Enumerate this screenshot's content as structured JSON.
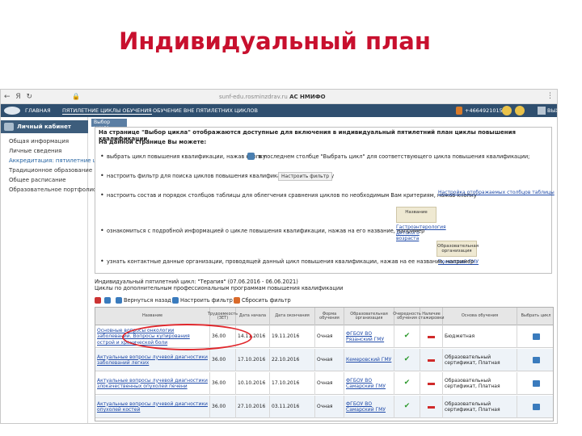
{
  "slide": {
    "title": "Индивидуальный план"
  },
  "browser": {
    "nav": "← Я ↻",
    "url_prefix": "sunf-edu.rosminzdrav.ru",
    "url_bold": "АС НМИФО",
    "menu": "⋮"
  },
  "app_header": {
    "menu": [
      "ГЛАВНАЯ",
      "ПЯТИЛЕТНИЕ ЦИКЛЫ ОБУЧЕНИЯ",
      "ОБУЧЕНИЕ ВНЕ ПЯТИЛЕТНИХ ЦИКЛОВ"
    ],
    "phone": "+4664921015",
    "exit": "ВЫХОД"
  },
  "sidebar": {
    "title": "Личный кабинет",
    "items": [
      {
        "label": "Общая информация"
      },
      {
        "label": "Личные сведения"
      },
      {
        "label": "Аккредитация: пятилетние цикл"
      },
      {
        "label": "Традиционное образование"
      },
      {
        "label": "Общее расписание"
      },
      {
        "label": "Образовательное портфолио"
      }
    ]
  },
  "main": {
    "tab": "Выбор цикла",
    "info_first": "На странице \"Выбор цикла\" отображаются доступные для включения в индивидуальный пятилетний план циклы повышения квалификации.",
    "info_heading": "На данной странице Вы можете:",
    "bullets": [
      {
        "a": "выбрать цикл повышения квалификации, нажав кнопку",
        "b": "в последнем столбце \"Выбрать цикл\" для соответствующего цикла повышения квалификации;"
      },
      {
        "a": "настроить фильтр для поиска циклов повышения квалификации, нажав кнопку"
      },
      {
        "a": "настроить состав и порядок столбцов таблицы для облегчения сравнения циклов по необходимым Вам критериям, нажав кнопку"
      },
      {
        "a": "ознакомиться с подробной информацией о цикле повышения квалификации, нажав на его название, например"
      },
      {
        "a": "узнать контактные данные организации, проводящей данный цикл повышения квалификации, нажав на ее название, например"
      }
    ],
    "filter_btn": "Настроить фильтр",
    "columns_link": "Настройка отображаемых столбцов таблицы",
    "sample_name_head": "Название",
    "sample_name_link": "Гастроэнтерология детского возраста",
    "sample_org_head": "Образовательная организация",
    "sample_org_link": "Тюменский ГМУ",
    "cycle_line1": "Индивидуальный пятилетний цикл: \"Терапия\" (07.06.2016 - 06.06.2021)",
    "cycle_line2": "Циклы по дополнительным профессиональным программам повышения квалификации"
  },
  "toolbar": {
    "back": "Вернуться назад",
    "filter": "Настроить фильтр",
    "reset": "Сбросить фильтр"
  },
  "table": {
    "headers": [
      "Название",
      "Трудоемкость (ЗЕТ)",
      "Дата начала",
      "Дата окончания",
      "Форма обучения",
      "Образовательная организация",
      "Очередность обучения",
      "Наличие стажировки",
      "Основа обучения",
      "Выбрать цикл"
    ],
    "rows": [
      {
        "name": "Основные вопросы онкологии заболеваний. Вопросы купирования острой и хронической боли",
        "zet": "36.00",
        "start": "14.11.2016",
        "end": "19.11.2016",
        "form": "Очная",
        "org": "ФГБОУ ВО Рязанский ГМУ",
        "basis": "Бюджетная"
      },
      {
        "name": "Актуальные вопросы лучевой диагностики заболеваний легких",
        "zet": "36.00",
        "start": "17.10.2016",
        "end": "22.10.2016",
        "form": "Очная",
        "org": "Кемеровский ГМУ",
        "basis": "Образовательный сертификат, Платная"
      },
      {
        "name": "Актуальные вопросы лучевой диагностики злокачественных опухолей печени",
        "zet": "36.00",
        "start": "10.10.2016",
        "end": "17.10.2016",
        "form": "Очная",
        "org": "ФГБОУ ВО Самарский ГМУ",
        "basis": "Образовательный сертификат, Платная"
      },
      {
        "name": "Актуальные вопросы лучевой диагностики опухолей костей",
        "zet": "36.00",
        "start": "27.10.2016",
        "end": "03.11.2016",
        "form": "Очная",
        "org": "ФГБОУ ВО Самарский ГМУ",
        "basis": "Образовательный сертификат, Платная"
      }
    ]
  },
  "colors": {
    "title": "#c8102e",
    "header": "#2f4f6f",
    "link": "#1f4aa8",
    "highlight": "#e0262b"
  }
}
